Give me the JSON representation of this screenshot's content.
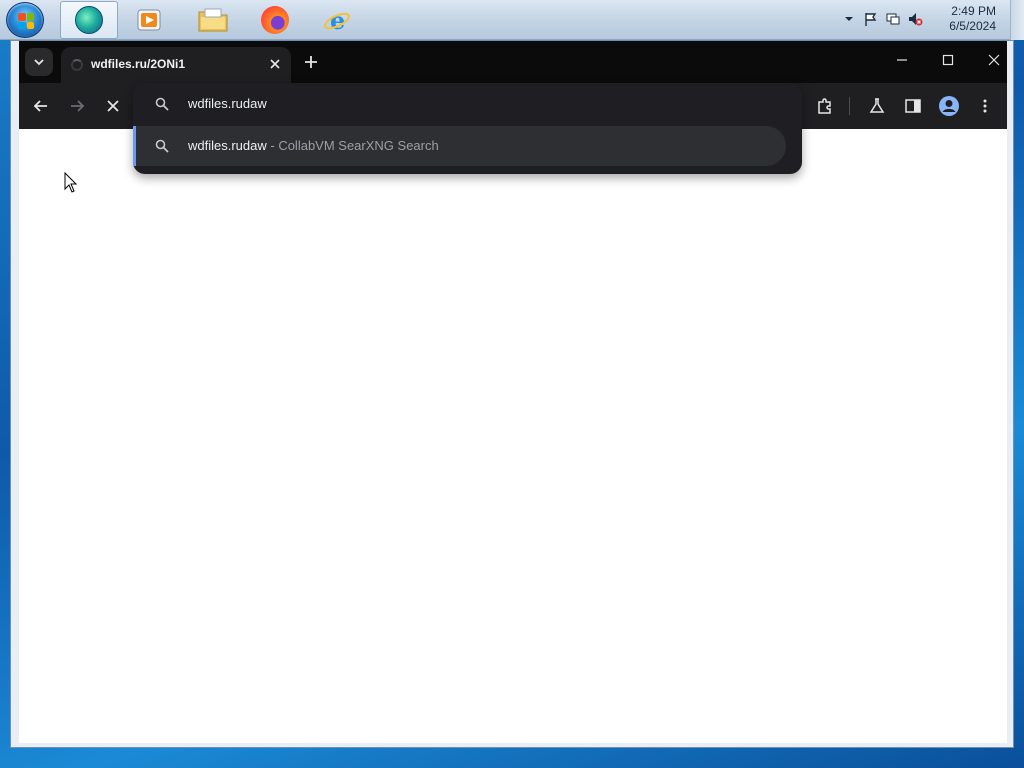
{
  "taskbar": {
    "apps": [
      {
        "name": "edge-app-icon"
      },
      {
        "name": "media-player-icon"
      },
      {
        "name": "file-explorer-icon"
      },
      {
        "name": "firefox-icon"
      },
      {
        "name": "internet-explorer-icon"
      }
    ],
    "clock": {
      "time": "2:49 PM",
      "date": "6/5/2024"
    }
  },
  "browser": {
    "tab": {
      "title": "wdfiles.ru/2ONi1"
    },
    "omnibox": {
      "input_text": "wdfiles.rudaw",
      "suggestion": {
        "main": "wdfiles.rudaw",
        "sub": " - CollabVM SearXNG Search"
      }
    }
  },
  "colors": {
    "titlebar": "#0b0b0c",
    "toolbar": "#1f1f22",
    "accent": "#6a9af0",
    "page": "#ffffff"
  }
}
